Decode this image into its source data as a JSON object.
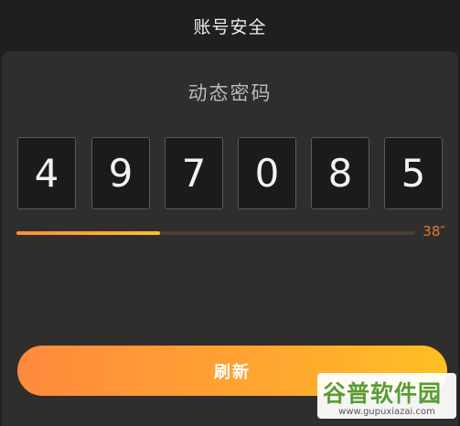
{
  "header": {
    "title": "账号安全"
  },
  "dynamic_password": {
    "title": "动态密码",
    "digits": [
      "4",
      "9",
      "7",
      "0",
      "8",
      "5"
    ],
    "countdown": "38″",
    "progress": 0.36
  },
  "actions": {
    "refresh_label": "刷新"
  },
  "watermark": {
    "name": "谷普软件园",
    "url": "www.gupuxiazai.com"
  },
  "colors": {
    "accent_start": "#ff8a3d",
    "accent_end": "#ffbf23",
    "countdown": "#e0792f",
    "background": "#1f1f1f",
    "card": "#2f2e2d"
  }
}
